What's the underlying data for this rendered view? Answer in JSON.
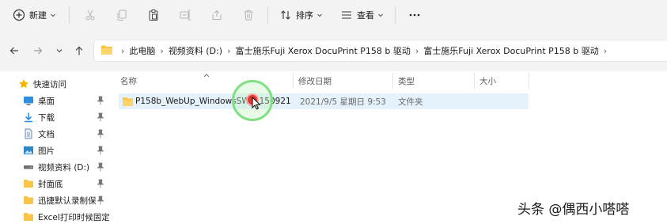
{
  "toolbar": {
    "new_label": "新建",
    "sort_label": "排序",
    "view_label": "查看"
  },
  "address": {
    "breadcrumbs": [
      "此电脑",
      "视频资料 (D:)",
      "富士施乐Fuji Xerox DocuPrint P158 b 驱动",
      "富士施乐Fuji Xerox DocuPrint P158 b 驱动"
    ]
  },
  "sidebar": {
    "items": [
      {
        "label": "快速访问",
        "icon": "star-icon",
        "color": "#f5b400"
      },
      {
        "label": "桌面",
        "icon": "desktop-icon",
        "color": "#2f8fdd",
        "pinned": true
      },
      {
        "label": "下载",
        "icon": "download-icon",
        "color": "#1e88e5",
        "pinned": true
      },
      {
        "label": "文档",
        "icon": "document-icon",
        "color": "#6a8caf",
        "pinned": true
      },
      {
        "label": "图片",
        "icon": "picture-icon",
        "color": "#2d87c9",
        "pinned": true
      },
      {
        "label": "视频资料 (D:)",
        "icon": "drive-icon",
        "color": "#707070",
        "pinned": true
      },
      {
        "label": "封面底",
        "icon": "folder-icon",
        "color": "#f8c54a",
        "pinned": true
      },
      {
        "label": "迅捷默认录制保",
        "icon": "folder-icon",
        "color": "#f8c54a",
        "pinned": true
      },
      {
        "label": "Excel打印时候固定",
        "icon": "folder-icon",
        "color": "#f8c54a"
      }
    ]
  },
  "columns": {
    "name": "名称",
    "modified": "修改日期",
    "type": "类型",
    "size": "大小"
  },
  "files": [
    {
      "name": "P158b_WebUp_WindowsSW_1150921",
      "modified": "2021/9/5 星期日 9:53",
      "type": "文件夹",
      "size": ""
    }
  ],
  "watermark": "头条 @偶西小嗒嗒",
  "colors": {
    "chrome_bg": "#f3f3f3",
    "selection": "#e5f1fb",
    "folder": "#f8c54a",
    "click_ring": "#7ee07e",
    "click_dot": "#e8352e"
  }
}
